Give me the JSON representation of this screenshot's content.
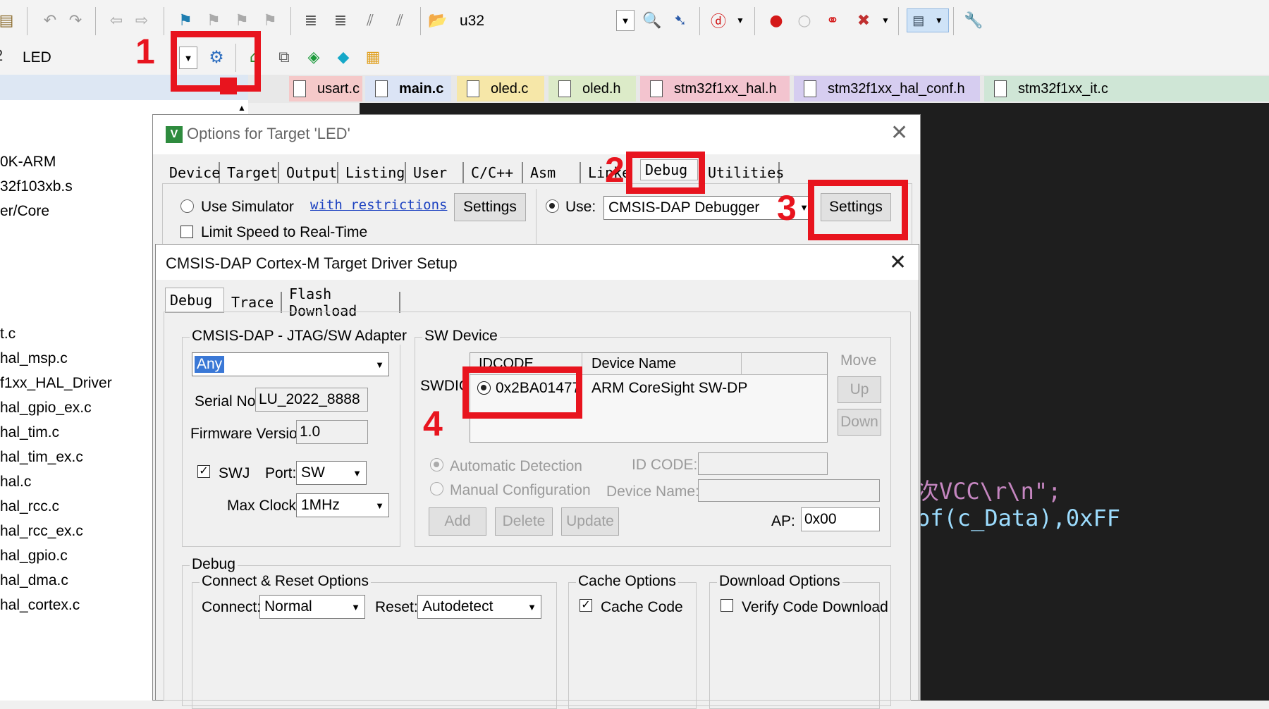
{
  "toolbar": {
    "target_combo": "u32",
    "project_combo": "LED"
  },
  "annotations": [
    "1",
    "2",
    "3",
    "4"
  ],
  "file_tabs": [
    {
      "label": "usart.c",
      "bg": "#f5c9c9"
    },
    {
      "label": "main.c",
      "bg": "#dbe4f5"
    },
    {
      "label": "oled.c",
      "bg": "#f6e7a8"
    },
    {
      "label": "oled.h",
      "bg": "#dcebc8"
    },
    {
      "label": "stm32f1xx_hal.h",
      "bg": "#f3c4cf"
    },
    {
      "label": "stm32f1xx_hal_conf.h",
      "bg": "#d6cdf0"
    },
    {
      "label": "stm32f1xx_it.c",
      "bg": "#cfe6d6"
    }
  ],
  "sidebar": {
    "items": [
      "0K-ARM",
      "32f103xb.s",
      "er/Core",
      "t.c",
      "hal_msp.c",
      "f1xx_HAL_Driver",
      "hal_gpio_ex.c",
      "hal_tim.c",
      "hal_tim_ex.c",
      "hal.c",
      "hal_rcc.c",
      "hal_rcc_ex.c",
      "hal_gpio.c",
      "hal_dma.c",
      "hal_cortex.c"
    ]
  },
  "code": {
    "line1": "次VCC\\r\\n\";",
    "line2": "of(c_Data),0xFF"
  },
  "options_dialog": {
    "title": "Options for Target 'LED'",
    "tabs": [
      "Device",
      "Target",
      "Output",
      "Listing",
      "User",
      "C/C++",
      "Asm",
      "Linker",
      "Debug",
      "Utilities"
    ],
    "use_simulator": "Use Simulator",
    "with_restrictions": "with restrictions",
    "settings_left": "Settings",
    "limit_speed": "Limit Speed to Real-Time",
    "use_label": "Use:",
    "debugger": "CMSIS-DAP Debugger",
    "settings_right": "Settings"
  },
  "driver_dialog": {
    "title": "CMSIS-DAP Cortex-M Target Driver Setup",
    "tabs": [
      "Debug",
      "Trace",
      "Flash Download"
    ],
    "adapter_group": "CMSIS-DAP - JTAG/SW Adapter",
    "adapter_value": "Any",
    "serial_label": "Serial No:",
    "serial_value": "LU_2022_8888",
    "firmware_label": "Firmware Version:",
    "firmware_value": "1.0",
    "swj_label": "SWJ",
    "port_label": "Port:",
    "port_value": "SW",
    "maxclock_label": "Max Clock:",
    "maxclock_value": "1MHz",
    "sw_group": "SW Device",
    "swdio_label": "SWDIO",
    "col_idcode": "IDCODE",
    "col_devname": "Device Name",
    "row_idcode": "0x2BA01477",
    "row_devname": "ARM CoreSight SW-DP",
    "move_label": "Move",
    "up_btn": "Up",
    "down_btn": "Down",
    "auto_detect": "Automatic Detection",
    "manual_config": "Manual Configuration",
    "idcode_label": "ID CODE:",
    "devname_label": "Device Name:",
    "add_btn": "Add",
    "delete_btn": "Delete",
    "update_btn": "Update",
    "ap_label": "AP:",
    "ap_value": "0x00",
    "debug_group": "Debug",
    "connect_group": "Connect & Reset Options",
    "connect_label": "Connect:",
    "connect_value": "Normal",
    "reset_label": "Reset:",
    "reset_value": "Autodetect",
    "cache_group": "Cache Options",
    "cache_code": "Cache Code",
    "download_group": "Download Options",
    "verify_download": "Verify Code Download"
  }
}
